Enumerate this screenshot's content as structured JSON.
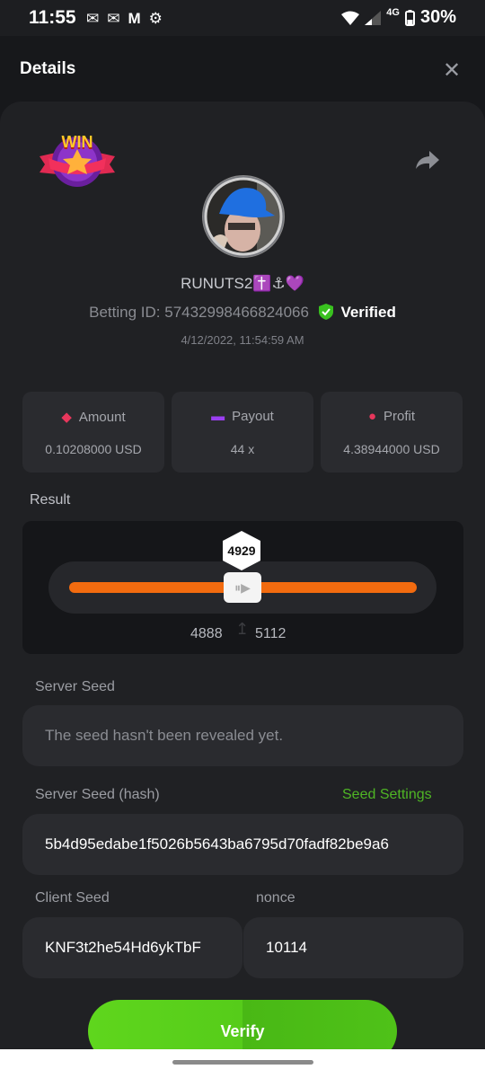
{
  "status": {
    "time": "11:55",
    "network": "4G",
    "battery": "30%"
  },
  "header": {
    "title": "Details",
    "close_glyph": "✕"
  },
  "bet": {
    "badge": "WIN",
    "username": "RUNUTS2✝️⚓💜",
    "betting_id_label": "Betting ID: 57432998466824066",
    "verified_label": "Verified",
    "datetime": "4/12/2022, 11:54:59 AM"
  },
  "stats": {
    "amount": {
      "label": "Amount",
      "value": "0.10208000 USD"
    },
    "payout": {
      "label": "Payout",
      "value": "44 x"
    },
    "profit": {
      "label": "Profit",
      "value": "4.38944000 USD"
    }
  },
  "result": {
    "label": "Result",
    "roll_value": "4929",
    "range_low": "4888",
    "range_high": "5112",
    "slider_position": 0.49
  },
  "server_seed": {
    "label": "Server Seed",
    "value": "The seed hasn't been revealed yet."
  },
  "server_seed_hash": {
    "label": "Server Seed (hash)",
    "settings_link": "Seed Settings",
    "value": "5b4d95edabe1f5026b5643ba6795d70fadf82be9a6"
  },
  "client_seed": {
    "label": "Client Seed",
    "value": "KNF3t2he54Hd6ykTbF"
  },
  "nonce": {
    "label": "nonce",
    "value": "10114"
  },
  "verify_button": "Verify",
  "colors": {
    "accent_green": "#56cc1a",
    "slider_orange": "#f26b0f",
    "verified_green": "#39c11f",
    "link_green": "#4fb624"
  }
}
